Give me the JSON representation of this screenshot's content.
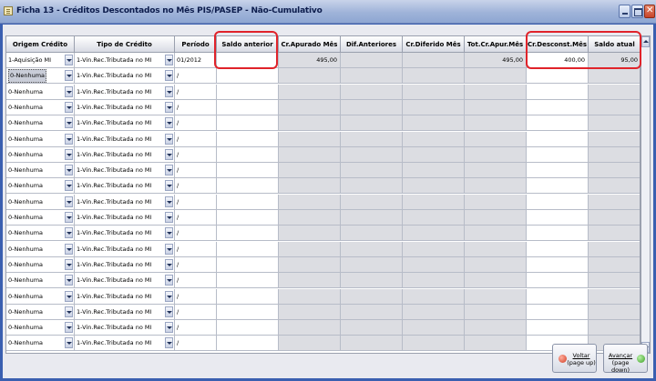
{
  "window": {
    "title": "Ficha 13 - Créditos Descontados no Mês PIS/PASEP - Não-Cumulativo"
  },
  "columns": [
    "Origem Crédito",
    "Tipo de Crédito",
    "Período",
    "Saldo anterior",
    "Cr.Apurado Mês",
    "Dif.Anteriores",
    "Cr.Diferido Mês",
    "Tot.Cr.Apur.Mês",
    "Cr.Desconst.Mês",
    "Saldo atual"
  ],
  "rows": [
    {
      "origem": "1-Aquisição MI",
      "tipo": "1-Vin.Rec.Tributada no MI",
      "periodo": "01/2012",
      "saldo_anterior": "",
      "cr_apurado": "495,00",
      "dif_anteriores": "",
      "cr_diferido": "",
      "tot_cr_apur": "495,00",
      "cr_desconst": "400,00",
      "saldo_atual": "95,00"
    },
    {
      "origem": "0-Nenhuma",
      "tipo": "1-Vin.Rec.Tributada no MI",
      "periodo": "/",
      "saldo_anterior": "",
      "cr_apurado": "",
      "dif_anteriores": "",
      "cr_diferido": "",
      "tot_cr_apur": "",
      "cr_desconst": "",
      "saldo_atual": "",
      "selected": true
    },
    {
      "origem": "0-Nenhuma",
      "tipo": "1-Vin.Rec.Tributada no MI",
      "periodo": "/",
      "saldo_anterior": "",
      "cr_apurado": "",
      "dif_anteriores": "",
      "cr_diferido": "",
      "tot_cr_apur": "",
      "cr_desconst": "",
      "saldo_atual": ""
    },
    {
      "origem": "0-Nenhuma",
      "tipo": "1-Vin.Rec.Tributada no MI",
      "periodo": "/",
      "saldo_anterior": "",
      "cr_apurado": "",
      "dif_anteriores": "",
      "cr_diferido": "",
      "tot_cr_apur": "",
      "cr_desconst": "",
      "saldo_atual": ""
    },
    {
      "origem": "0-Nenhuma",
      "tipo": "1-Vin.Rec.Tributada no MI",
      "periodo": "/",
      "saldo_anterior": "",
      "cr_apurado": "",
      "dif_anteriores": "",
      "cr_diferido": "",
      "tot_cr_apur": "",
      "cr_desconst": "",
      "saldo_atual": ""
    },
    {
      "origem": "0-Nenhuma",
      "tipo": "1-Vin.Rec.Tributada no MI",
      "periodo": "/",
      "saldo_anterior": "",
      "cr_apurado": "",
      "dif_anteriores": "",
      "cr_diferido": "",
      "tot_cr_apur": "",
      "cr_desconst": "",
      "saldo_atual": ""
    },
    {
      "origem": "0-Nenhuma",
      "tipo": "1-Vin.Rec.Tributada no MI",
      "periodo": "/",
      "saldo_anterior": "",
      "cr_apurado": "",
      "dif_anteriores": "",
      "cr_diferido": "",
      "tot_cr_apur": "",
      "cr_desconst": "",
      "saldo_atual": ""
    },
    {
      "origem": "0-Nenhuma",
      "tipo": "1-Vin.Rec.Tributada no MI",
      "periodo": "/",
      "saldo_anterior": "",
      "cr_apurado": "",
      "dif_anteriores": "",
      "cr_diferido": "",
      "tot_cr_apur": "",
      "cr_desconst": "",
      "saldo_atual": ""
    },
    {
      "origem": "0-Nenhuma",
      "tipo": "1-Vin.Rec.Tributada no MI",
      "periodo": "/",
      "saldo_anterior": "",
      "cr_apurado": "",
      "dif_anteriores": "",
      "cr_diferido": "",
      "tot_cr_apur": "",
      "cr_desconst": "",
      "saldo_atual": ""
    },
    {
      "origem": "0-Nenhuma",
      "tipo": "1-Vin.Rec.Tributada no MI",
      "periodo": "/",
      "saldo_anterior": "",
      "cr_apurado": "",
      "dif_anteriores": "",
      "cr_diferido": "",
      "tot_cr_apur": "",
      "cr_desconst": "",
      "saldo_atual": ""
    },
    {
      "origem": "0-Nenhuma",
      "tipo": "1-Vin.Rec.Tributada no MI",
      "periodo": "/",
      "saldo_anterior": "",
      "cr_apurado": "",
      "dif_anteriores": "",
      "cr_diferido": "",
      "tot_cr_apur": "",
      "cr_desconst": "",
      "saldo_atual": ""
    },
    {
      "origem": "0-Nenhuma",
      "tipo": "1-Vin.Rec.Tributada no MI",
      "periodo": "/",
      "saldo_anterior": "",
      "cr_apurado": "",
      "dif_anteriores": "",
      "cr_diferido": "",
      "tot_cr_apur": "",
      "cr_desconst": "",
      "saldo_atual": ""
    },
    {
      "origem": "0-Nenhuma",
      "tipo": "1-Vin.Rec.Tributada no MI",
      "periodo": "/",
      "saldo_anterior": "",
      "cr_apurado": "",
      "dif_anteriores": "",
      "cr_diferido": "",
      "tot_cr_apur": "",
      "cr_desconst": "",
      "saldo_atual": ""
    },
    {
      "origem": "0-Nenhuma",
      "tipo": "1-Vin.Rec.Tributada no MI",
      "periodo": "/",
      "saldo_anterior": "",
      "cr_apurado": "",
      "dif_anteriores": "",
      "cr_diferido": "",
      "tot_cr_apur": "",
      "cr_desconst": "",
      "saldo_atual": ""
    },
    {
      "origem": "0-Nenhuma",
      "tipo": "1-Vin.Rec.Tributada no MI",
      "periodo": "/",
      "saldo_anterior": "",
      "cr_apurado": "",
      "dif_anteriores": "",
      "cr_diferido": "",
      "tot_cr_apur": "",
      "cr_desconst": "",
      "saldo_atual": ""
    },
    {
      "origem": "0-Nenhuma",
      "tipo": "1-Vin.Rec.Tributada no MI",
      "periodo": "/",
      "saldo_anterior": "",
      "cr_apurado": "",
      "dif_anteriores": "",
      "cr_diferido": "",
      "tot_cr_apur": "",
      "cr_desconst": "",
      "saldo_atual": ""
    },
    {
      "origem": "0-Nenhuma",
      "tipo": "1-Vin.Rec.Tributada no MI",
      "periodo": "/",
      "saldo_anterior": "",
      "cr_apurado": "",
      "dif_anteriores": "",
      "cr_diferido": "",
      "tot_cr_apur": "",
      "cr_desconst": "",
      "saldo_atual": ""
    },
    {
      "origem": "0-Nenhuma",
      "tipo": "1-Vin.Rec.Tributada no MI",
      "periodo": "/",
      "saldo_anterior": "",
      "cr_apurado": "",
      "dif_anteriores": "",
      "cr_diferido": "",
      "tot_cr_apur": "",
      "cr_desconst": "",
      "saldo_atual": ""
    },
    {
      "origem": "0-Nenhuma",
      "tipo": "1-Vin.Rec.Tributada no MI",
      "periodo": "/",
      "saldo_anterior": "",
      "cr_apurado": "",
      "dif_anteriores": "",
      "cr_diferido": "",
      "tot_cr_apur": "",
      "cr_desconst": "",
      "saldo_atual": ""
    }
  ],
  "buttons": {
    "back": {
      "line1": "Voltar",
      "line2": "(page up)",
      "icon": "red-arrow-left-icon"
    },
    "next": {
      "line1": "Avançar",
      "line2": "(page down)",
      "icon": "green-arrow-right-icon"
    }
  },
  "highlight_color": "#e0232a"
}
